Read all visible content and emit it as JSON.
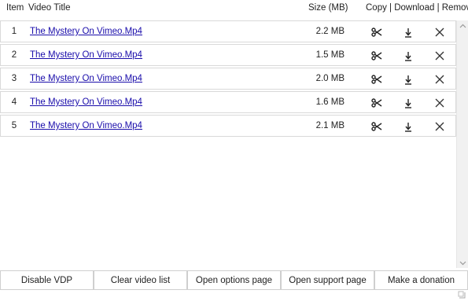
{
  "header": {
    "item": "Item",
    "title": "Video Title",
    "size": "Size (MB)",
    "actions": "Copy | Download | Remove"
  },
  "rows": [
    {
      "num": "1",
      "title": "The Mystery On Vimeo.Mp4",
      "size": "2.2 MB"
    },
    {
      "num": "2",
      "title": "The Mystery On Vimeo.Mp4",
      "size": "1.5 MB"
    },
    {
      "num": "3",
      "title": "The Mystery On Vimeo.Mp4",
      "size": "2.0 MB"
    },
    {
      "num": "4",
      "title": "The Mystery On Vimeo.Mp4",
      "size": "1.6 MB"
    },
    {
      "num": "5",
      "title": "The Mystery On Vimeo.Mp4",
      "size": "2.1 MB"
    }
  ],
  "icons": {
    "copy": "scissors-icon",
    "download": "download-icon",
    "remove": "close-icon"
  },
  "footer": {
    "disable": "Disable VDP",
    "clear": "Clear video list",
    "options": "Open options page",
    "support": "Open support page",
    "donate": "Make a donation"
  },
  "colors": {
    "link": "#1a0dab",
    "border": "#d9d9d9"
  }
}
